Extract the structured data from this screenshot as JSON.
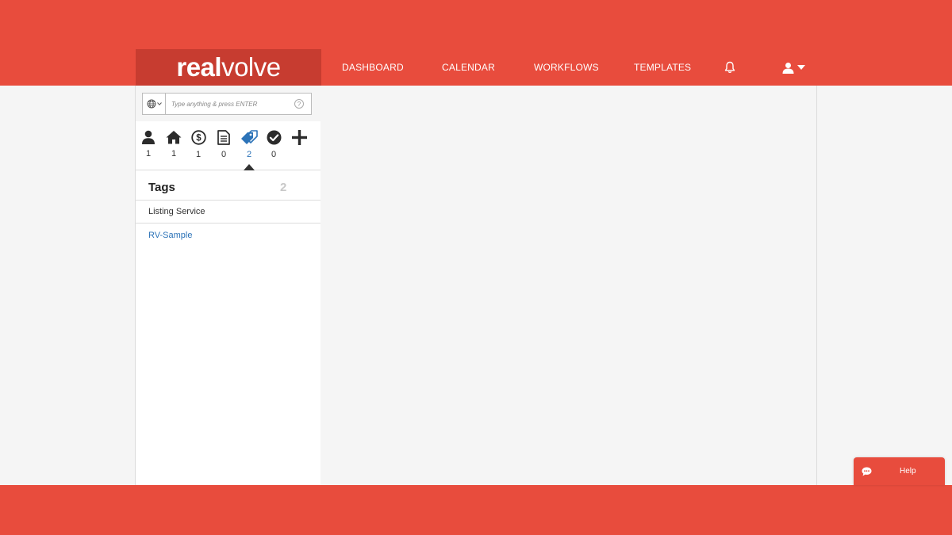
{
  "brand": {
    "logo_bold": "real",
    "logo_light": "volve"
  },
  "nav": {
    "items": [
      {
        "label": "DASHBOARD"
      },
      {
        "label": "CALENDAR"
      },
      {
        "label": "WORKFLOWS"
      },
      {
        "label": "TEMPLATES"
      }
    ],
    "icons": [
      "bell-icon",
      "user-icon",
      "caret-down-icon"
    ]
  },
  "search": {
    "placeholder": "Type anything & press ENTER",
    "value": "",
    "help_glyph": "?"
  },
  "categories": [
    {
      "icon": "person-icon",
      "count": "1"
    },
    {
      "icon": "home-icon",
      "count": "1"
    },
    {
      "icon": "dollar-icon",
      "count": "1"
    },
    {
      "icon": "document-icon",
      "count": "0"
    },
    {
      "icon": "tags-icon",
      "count": "2",
      "active": true
    },
    {
      "icon": "check-circle-icon",
      "count": "0"
    },
    {
      "icon": "plus-icon",
      "count": ""
    }
  ],
  "tags_panel": {
    "title": "Tags",
    "count": "2",
    "items": [
      {
        "label": "Listing Service"
      },
      {
        "label": "RV-Sample"
      }
    ]
  },
  "help_widget": {
    "label": "Help"
  },
  "colors": {
    "brand_red": "#e84c3d",
    "logo_box": "#c73c30",
    "link_blue": "#2c73b8",
    "background": "#f5f5f5"
  }
}
